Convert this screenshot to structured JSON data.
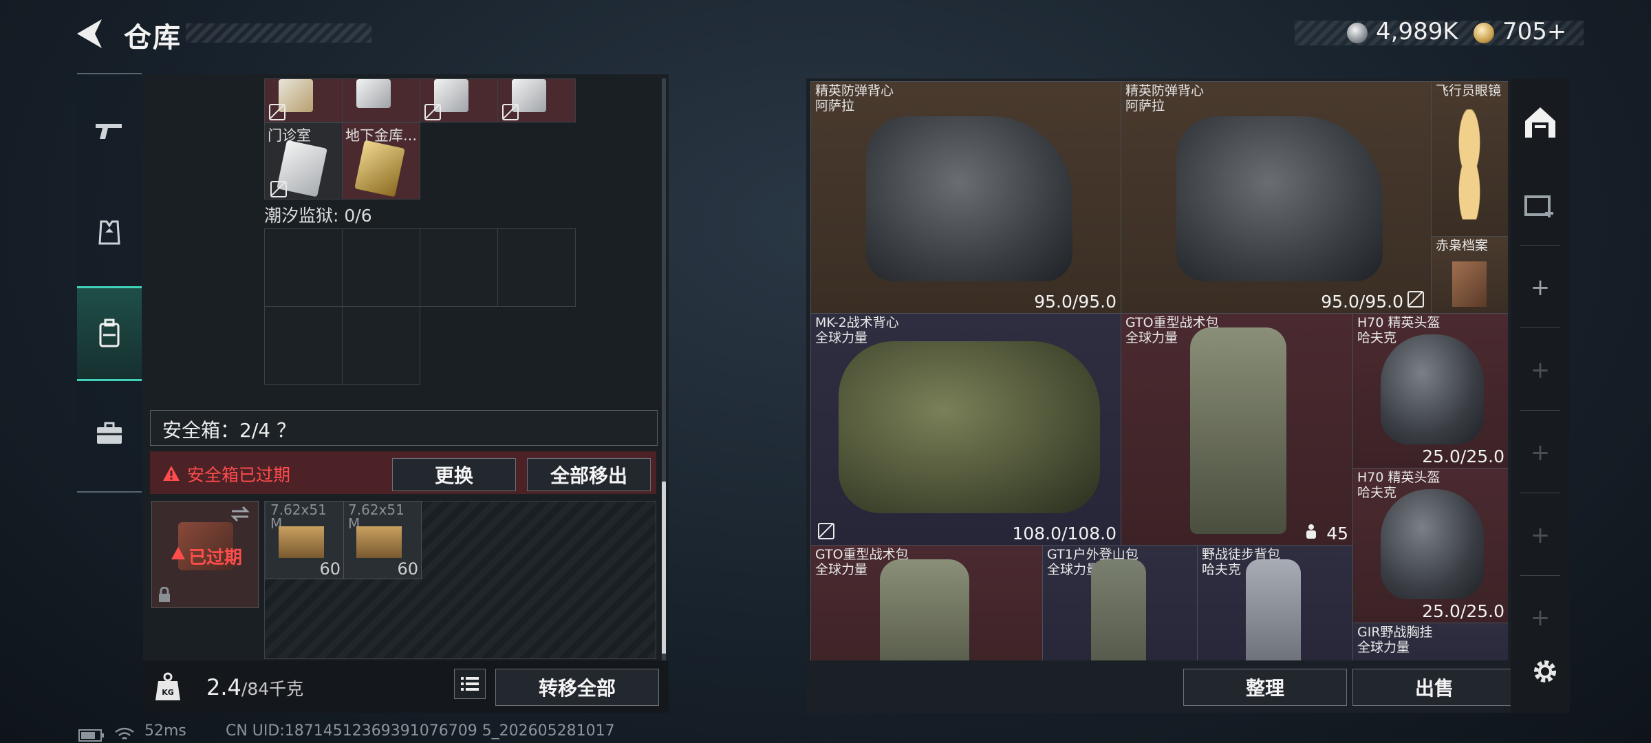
{
  "header": {
    "title": "仓库",
    "currency_silver": "4,989K",
    "currency_gold": "705+"
  },
  "left_nav": {
    "items": [
      "gun-icon",
      "armor-icon",
      "backpack-icon",
      "briefcase-icon"
    ],
    "active_index": 2
  },
  "left_panel": {
    "cards_row2": [
      {
        "label": "门诊室"
      },
      {
        "label": "地下金库..."
      }
    ],
    "prison_label": "潮汐监狱: 0/6",
    "safebox_label": "安全箱：2/4 ？",
    "warning": "安全箱已过期",
    "btn_replace": "更换",
    "btn_move_all": "全部移出",
    "expired_badge": "已过期",
    "ammo": [
      {
        "label": "7.62x51\nM...",
        "count": "60"
      },
      {
        "label": "7.62x51\nM...",
        "count": "60"
      }
    ],
    "weight_value": "2.4",
    "weight_max": "/84千克",
    "btn_transfer_all": "转移全部"
  },
  "status_bar": {
    "ping": "52ms",
    "uid": "CN UID:18714512369391076709 5_202605281017"
  },
  "stash": {
    "items": [
      {
        "name": "精英防弹背心",
        "sub": "阿萨拉",
        "value": "95.0/95.0"
      },
      {
        "name": "精英防弹背心",
        "sub": "阿萨拉",
        "value": "95.0/95.0"
      },
      {
        "name": "飞行员眼镜",
        "sub": "",
        "value": ""
      },
      {
        "name": "赤枭档案",
        "sub": "",
        "value": ""
      },
      {
        "name": "MK-2战术背心",
        "sub": "全球力量",
        "value": "108.0/108.0"
      },
      {
        "name": "GTO重型战术包",
        "sub": "全球力量",
        "value": "45"
      },
      {
        "name": "H70 精英头盔",
        "sub": "哈夫克",
        "value": "25.0/25.0"
      },
      {
        "name": "H70 精英头盔",
        "sub": "哈夫克",
        "value": "25.0/25.0"
      },
      {
        "name": "GTO重型战术包",
        "sub": "全球力量",
        "value": ""
      },
      {
        "name": "GT1户外登山包",
        "sub": "全球力量",
        "value": ""
      },
      {
        "name": "野战徒步背包",
        "sub": "哈夫克",
        "value": ""
      },
      {
        "name": "GIR野战胸挂",
        "sub": "全球力量",
        "value": ""
      }
    ],
    "btn_sort": "整理",
    "btn_sell": "出售"
  }
}
